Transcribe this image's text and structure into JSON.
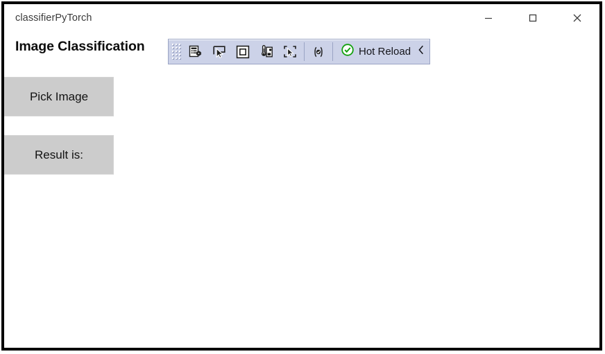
{
  "window": {
    "title": "classifierPyTorch",
    "controls": [
      {
        "name": "minimize-button",
        "icon": "minimize-icon",
        "label": "Minimize"
      },
      {
        "name": "maximize-button",
        "icon": "maximize-icon",
        "label": "Maximize"
      },
      {
        "name": "close-button",
        "icon": "close-icon",
        "label": "Close"
      }
    ]
  },
  "page": {
    "title": "Image Classification"
  },
  "hot_reload_toolbar": {
    "grip": "drag-grip",
    "buttons": [
      {
        "name": "select-element-tree-button",
        "icon": "element-properties-icon",
        "tooltip": "Go to Live Visual Tree"
      },
      {
        "name": "select-element-button",
        "icon": "pointer-select-icon",
        "tooltip": "Enable selection"
      },
      {
        "name": "display-layout-adorner-button",
        "icon": "layout-adorner-icon",
        "tooltip": "Display layout adorners"
      },
      {
        "name": "track-focused-element-button",
        "icon": "theme-preview-icon",
        "tooltip": "Preview theme / appearance"
      },
      {
        "name": "select-in-source-button",
        "icon": "select-in-xaml-icon",
        "tooltip": "Select element in XAML source"
      },
      {
        "name": "xaml-binding-failures-button",
        "icon": "xaml-braces-icon",
        "tooltip": "XAML Binding Failures"
      }
    ],
    "status": {
      "icon": "hot-reload-enabled-icon",
      "label": "Hot Reload"
    },
    "collapse": {
      "icon": "chevron-left-icon",
      "label": "Collapse toolbar"
    }
  },
  "content": {
    "buttons": [
      {
        "name": "pick-image-button",
        "label": "Pick Image"
      },
      {
        "name": "result-button",
        "label": "Result is:"
      }
    ]
  },
  "colors": {
    "window_border": "#000000",
    "client_background": "#ffffff",
    "title_text": "#3a3a3a",
    "heading_text": "#0d0d0d",
    "toolbar_background": "#ccd2e8",
    "toolbar_border": "#9aa4c4",
    "toolbar_icon": "#1f1f1f",
    "button_background": "#cccccc",
    "button_text": "#121212",
    "hot_reload_green": "#13a10e"
  }
}
